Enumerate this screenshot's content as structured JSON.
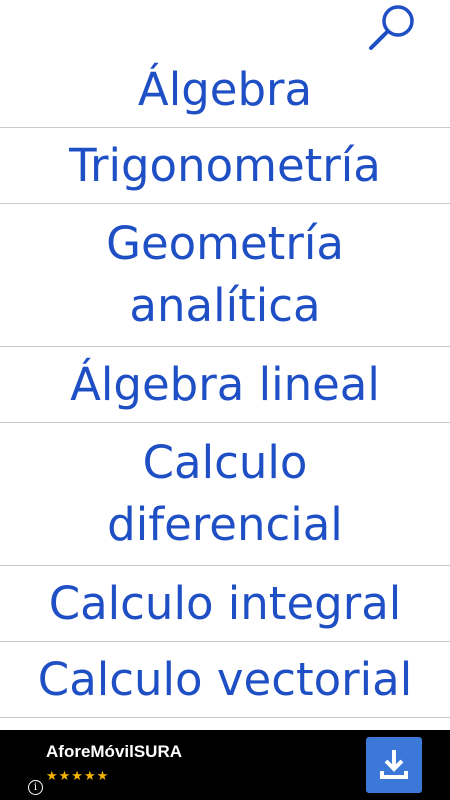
{
  "header": {
    "search_icon": "search-icon"
  },
  "menu": {
    "color": "#1f4fc4",
    "items": [
      {
        "lines": [
          "Álgebra"
        ]
      },
      {
        "lines": [
          "Trigonometría"
        ]
      },
      {
        "lines": [
          "Geometría",
          "analítica"
        ]
      },
      {
        "lines": [
          "Álgebra lineal"
        ]
      },
      {
        "lines": [
          "Calculo",
          "diferencial"
        ]
      },
      {
        "lines": [
          "Calculo integral"
        ]
      },
      {
        "lines": [
          "Calculo vectorial"
        ]
      }
    ]
  },
  "ad": {
    "title": "AforeMóvilSURA",
    "rating_stars": "★★★★★",
    "info_icon": "info-icon",
    "info_glyph": "i",
    "download_icon": "download-icon",
    "button_color": "#3b78d8",
    "star_color": "#f5b400"
  }
}
